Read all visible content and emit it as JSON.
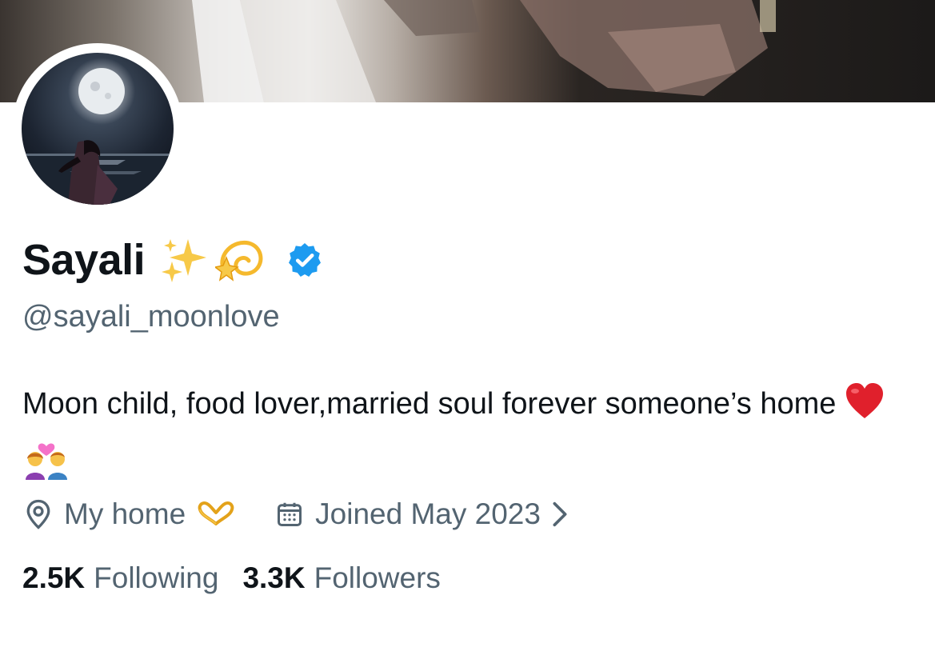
{
  "profile": {
    "display_name": "Sayali",
    "name_emojis": [
      "sparkles-emoji",
      "dizzy-emoji"
    ],
    "verified_badge": "verified-badge-icon",
    "handle": "@sayali_moonlove",
    "bio_text": "Moon child, food lover,married soul forever someone’s home",
    "bio_emojis": [
      "red-heart-emoji",
      "couple-with-heart-emoji"
    ],
    "location": "My home",
    "location_emoji": "heart-hands-emoji",
    "joined": "Joined May 2023",
    "following_count": "2.5K",
    "following_label": "Following",
    "followers_count": "3.3K",
    "followers_label": "Followers"
  },
  "colors": {
    "text_primary": "#0f1419",
    "text_secondary": "#536471",
    "verified_blue": "#1d9bf0"
  }
}
